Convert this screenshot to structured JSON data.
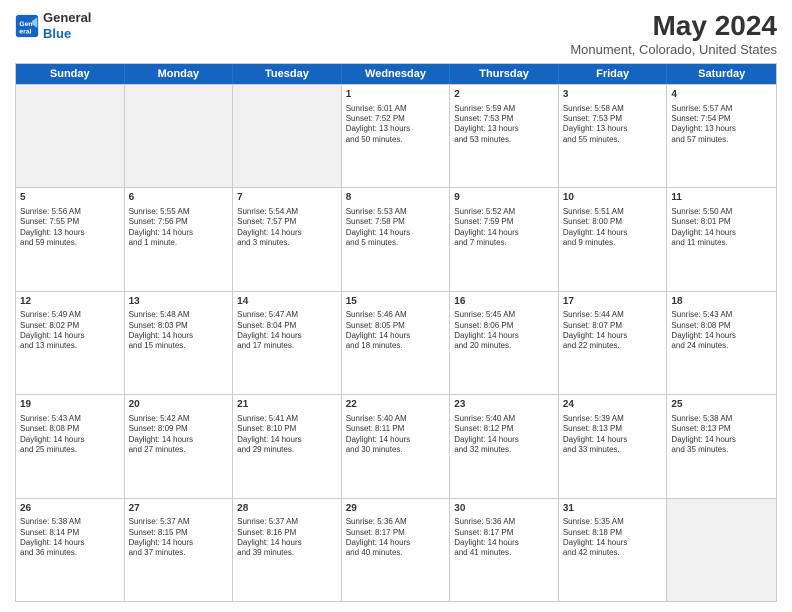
{
  "header": {
    "logo_line1": "General",
    "logo_line2": "Blue",
    "main_title": "May 2024",
    "subtitle": "Monument, Colorado, United States"
  },
  "days_of_week": [
    "Sunday",
    "Monday",
    "Tuesday",
    "Wednesday",
    "Thursday",
    "Friday",
    "Saturday"
  ],
  "weeks": [
    [
      {
        "day": "",
        "lines": [],
        "shaded": true
      },
      {
        "day": "",
        "lines": [],
        "shaded": true
      },
      {
        "day": "",
        "lines": [],
        "shaded": true
      },
      {
        "day": "1",
        "lines": [
          "Sunrise: 6:01 AM",
          "Sunset: 7:52 PM",
          "Daylight: 13 hours",
          "and 50 minutes."
        ],
        "shaded": false
      },
      {
        "day": "2",
        "lines": [
          "Sunrise: 5:59 AM",
          "Sunset: 7:53 PM",
          "Daylight: 13 hours",
          "and 53 minutes."
        ],
        "shaded": false
      },
      {
        "day": "3",
        "lines": [
          "Sunrise: 5:58 AM",
          "Sunset: 7:53 PM",
          "Daylight: 13 hours",
          "and 55 minutes."
        ],
        "shaded": false
      },
      {
        "day": "4",
        "lines": [
          "Sunrise: 5:57 AM",
          "Sunset: 7:54 PM",
          "Daylight: 13 hours",
          "and 57 minutes."
        ],
        "shaded": false
      }
    ],
    [
      {
        "day": "5",
        "lines": [
          "Sunrise: 5:56 AM",
          "Sunset: 7:55 PM",
          "Daylight: 13 hours",
          "and 59 minutes."
        ],
        "shaded": false
      },
      {
        "day": "6",
        "lines": [
          "Sunrise: 5:55 AM",
          "Sunset: 7:56 PM",
          "Daylight: 14 hours",
          "and 1 minute."
        ],
        "shaded": false
      },
      {
        "day": "7",
        "lines": [
          "Sunrise: 5:54 AM",
          "Sunset: 7:57 PM",
          "Daylight: 14 hours",
          "and 3 minutes."
        ],
        "shaded": false
      },
      {
        "day": "8",
        "lines": [
          "Sunrise: 5:53 AM",
          "Sunset: 7:58 PM",
          "Daylight: 14 hours",
          "and 5 minutes."
        ],
        "shaded": false
      },
      {
        "day": "9",
        "lines": [
          "Sunrise: 5:52 AM",
          "Sunset: 7:59 PM",
          "Daylight: 14 hours",
          "and 7 minutes."
        ],
        "shaded": false
      },
      {
        "day": "10",
        "lines": [
          "Sunrise: 5:51 AM",
          "Sunset: 8:00 PM",
          "Daylight: 14 hours",
          "and 9 minutes."
        ],
        "shaded": false
      },
      {
        "day": "11",
        "lines": [
          "Sunrise: 5:50 AM",
          "Sunset: 8:01 PM",
          "Daylight: 14 hours",
          "and 11 minutes."
        ],
        "shaded": false
      }
    ],
    [
      {
        "day": "12",
        "lines": [
          "Sunrise: 5:49 AM",
          "Sunset: 8:02 PM",
          "Daylight: 14 hours",
          "and 13 minutes."
        ],
        "shaded": false
      },
      {
        "day": "13",
        "lines": [
          "Sunrise: 5:48 AM",
          "Sunset: 8:03 PM",
          "Daylight: 14 hours",
          "and 15 minutes."
        ],
        "shaded": false
      },
      {
        "day": "14",
        "lines": [
          "Sunrise: 5:47 AM",
          "Sunset: 8:04 PM",
          "Daylight: 14 hours",
          "and 17 minutes."
        ],
        "shaded": false
      },
      {
        "day": "15",
        "lines": [
          "Sunrise: 5:46 AM",
          "Sunset: 8:05 PM",
          "Daylight: 14 hours",
          "and 18 minutes."
        ],
        "shaded": false
      },
      {
        "day": "16",
        "lines": [
          "Sunrise: 5:45 AM",
          "Sunset: 8:06 PM",
          "Daylight: 14 hours",
          "and 20 minutes."
        ],
        "shaded": false
      },
      {
        "day": "17",
        "lines": [
          "Sunrise: 5:44 AM",
          "Sunset: 8:07 PM",
          "Daylight: 14 hours",
          "and 22 minutes."
        ],
        "shaded": false
      },
      {
        "day": "18",
        "lines": [
          "Sunrise: 5:43 AM",
          "Sunset: 8:08 PM",
          "Daylight: 14 hours",
          "and 24 minutes."
        ],
        "shaded": false
      }
    ],
    [
      {
        "day": "19",
        "lines": [
          "Sunrise: 5:43 AM",
          "Sunset: 8:08 PM",
          "Daylight: 14 hours",
          "and 25 minutes."
        ],
        "shaded": false
      },
      {
        "day": "20",
        "lines": [
          "Sunrise: 5:42 AM",
          "Sunset: 8:09 PM",
          "Daylight: 14 hours",
          "and 27 minutes."
        ],
        "shaded": false
      },
      {
        "day": "21",
        "lines": [
          "Sunrise: 5:41 AM",
          "Sunset: 8:10 PM",
          "Daylight: 14 hours",
          "and 29 minutes."
        ],
        "shaded": false
      },
      {
        "day": "22",
        "lines": [
          "Sunrise: 5:40 AM",
          "Sunset: 8:11 PM",
          "Daylight: 14 hours",
          "and 30 minutes."
        ],
        "shaded": false
      },
      {
        "day": "23",
        "lines": [
          "Sunrise: 5:40 AM",
          "Sunset: 8:12 PM",
          "Daylight: 14 hours",
          "and 32 minutes."
        ],
        "shaded": false
      },
      {
        "day": "24",
        "lines": [
          "Sunrise: 5:39 AM",
          "Sunset: 8:13 PM",
          "Daylight: 14 hours",
          "and 33 minutes."
        ],
        "shaded": false
      },
      {
        "day": "25",
        "lines": [
          "Sunrise: 5:38 AM",
          "Sunset: 8:13 PM",
          "Daylight: 14 hours",
          "and 35 minutes."
        ],
        "shaded": false
      }
    ],
    [
      {
        "day": "26",
        "lines": [
          "Sunrise: 5:38 AM",
          "Sunset: 8:14 PM",
          "Daylight: 14 hours",
          "and 36 minutes."
        ],
        "shaded": false
      },
      {
        "day": "27",
        "lines": [
          "Sunrise: 5:37 AM",
          "Sunset: 8:15 PM",
          "Daylight: 14 hours",
          "and 37 minutes."
        ],
        "shaded": false
      },
      {
        "day": "28",
        "lines": [
          "Sunrise: 5:37 AM",
          "Sunset: 8:16 PM",
          "Daylight: 14 hours",
          "and 39 minutes."
        ],
        "shaded": false
      },
      {
        "day": "29",
        "lines": [
          "Sunrise: 5:36 AM",
          "Sunset: 8:17 PM",
          "Daylight: 14 hours",
          "and 40 minutes."
        ],
        "shaded": false
      },
      {
        "day": "30",
        "lines": [
          "Sunrise: 5:36 AM",
          "Sunset: 8:17 PM",
          "Daylight: 14 hours",
          "and 41 minutes."
        ],
        "shaded": false
      },
      {
        "day": "31",
        "lines": [
          "Sunrise: 5:35 AM",
          "Sunset: 8:18 PM",
          "Daylight: 14 hours",
          "and 42 minutes."
        ],
        "shaded": false
      },
      {
        "day": "",
        "lines": [],
        "shaded": true
      }
    ]
  ]
}
